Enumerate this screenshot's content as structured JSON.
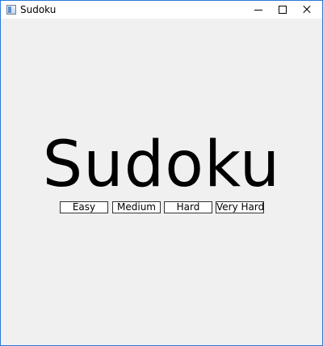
{
  "window": {
    "title": "Sudoku",
    "controls": {
      "minimize_icon": "minimize-icon",
      "maximize_icon": "maximize-icon",
      "close_icon": "close-icon"
    }
  },
  "main": {
    "title": "Sudoku",
    "buttons": [
      {
        "label": "Easy"
      },
      {
        "label": "Medium"
      },
      {
        "label": "Hard"
      },
      {
        "label": "Very Hard"
      }
    ]
  },
  "colors": {
    "window_border": "#2b79d6",
    "client_background": "#f0f0f0",
    "button_background": "#ffffff",
    "button_border": "#333333"
  }
}
